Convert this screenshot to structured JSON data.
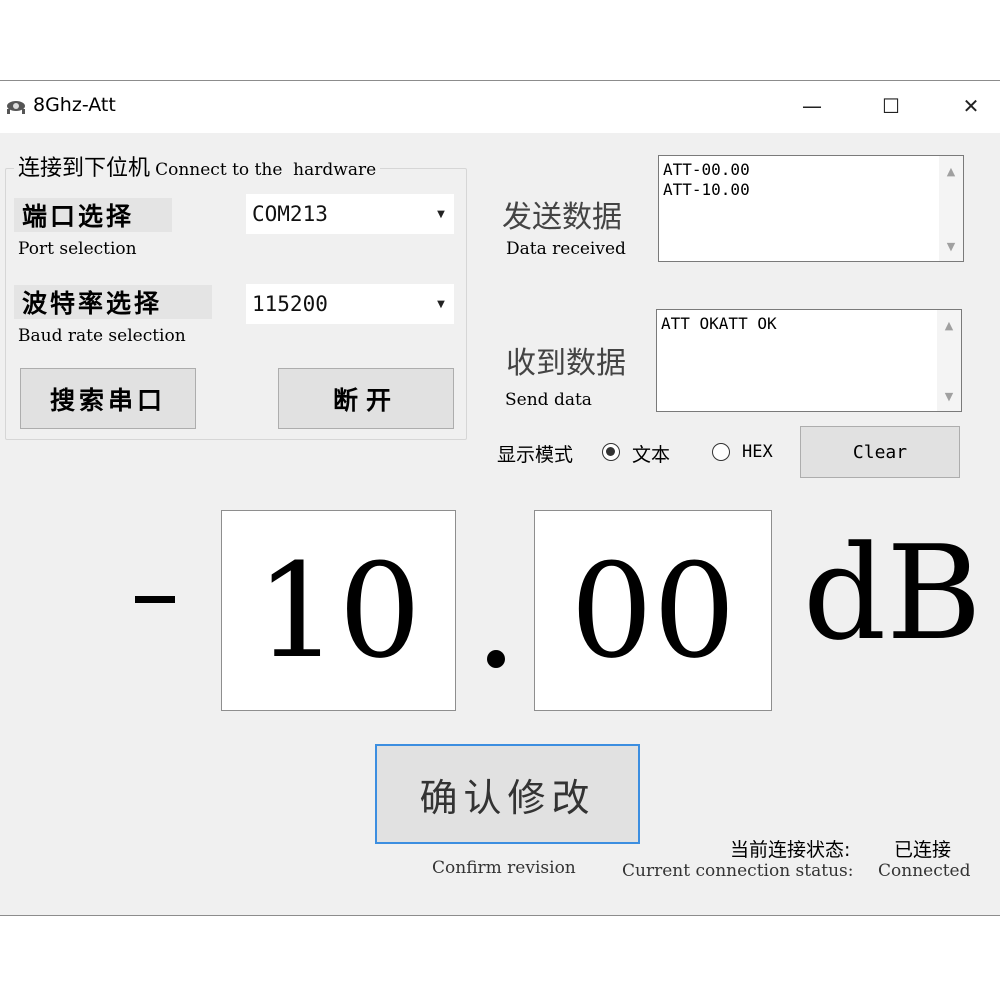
{
  "window": {
    "title": "8Ghz-Att",
    "minimize_glyph": "—",
    "maximize_glyph": "☐",
    "close_glyph": "✕"
  },
  "connection_group": {
    "title_cn": "连接到下位机",
    "title_en": "Connect to the  hardware",
    "port_label_cn": "端口选择",
    "port_label_en": "Port selection",
    "port_value": "COM213",
    "baud_label_cn": "波特率选择",
    "baud_label_en": "Baud rate selection",
    "baud_value": "115200",
    "search_button": "搜索串口",
    "disconnect_button": "断开"
  },
  "send_section": {
    "label_cn": "发送数据",
    "label_en": "Data received",
    "text": "ATT-00.00\nATT-10.00"
  },
  "receive_section": {
    "label_cn": "收到数据",
    "label_en": "Send data",
    "text": "ATT OKATT OK"
  },
  "display_mode": {
    "label": "显示模式",
    "option_text": "文本",
    "option_hex": "HEX",
    "selected": "text",
    "clear_button": "Clear"
  },
  "attenuation": {
    "sign": "-",
    "integer": "10",
    "decimal_point": ".",
    "fraction": "00",
    "unit": "dB"
  },
  "confirm": {
    "button": "确认修改",
    "caption": "Confirm revision"
  },
  "status": {
    "label_cn": "当前连接状态:",
    "value_cn": "已连接",
    "label_en": "Current connection status:",
    "value_en": "Connected"
  }
}
